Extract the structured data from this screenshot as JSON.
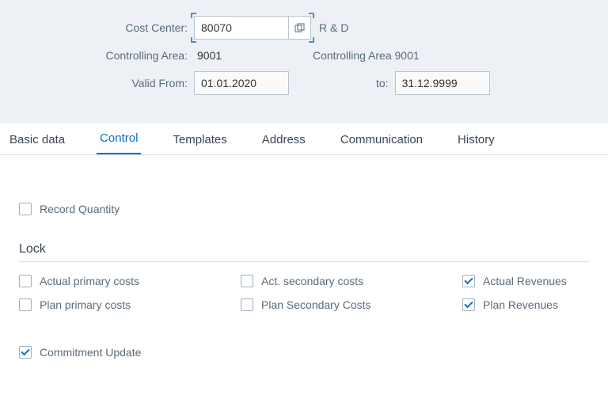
{
  "header": {
    "cost_center_label": "Cost Center:",
    "cost_center_value": "80070",
    "cost_center_desc": "R & D",
    "controlling_area_label": "Controlling Area:",
    "controlling_area_value": "9001",
    "controlling_area_desc": "Controlling Area 9001",
    "valid_from_label": "Valid From:",
    "valid_from_value": "01.01.2020",
    "to_label": "to:",
    "valid_to_value": "31.12.9999"
  },
  "tabs": {
    "items": [
      {
        "label": "Basic data"
      },
      {
        "label": "Control"
      },
      {
        "label": "Templates"
      },
      {
        "label": "Address"
      },
      {
        "label": "Communication"
      },
      {
        "label": "History"
      }
    ],
    "active_index": 1
  },
  "control": {
    "record_quantity": {
      "label": "Record Quantity",
      "checked": false
    },
    "lock_section_title": "Lock",
    "locks": {
      "actual_primary": {
        "label": "Actual primary costs",
        "checked": false
      },
      "act_secondary": {
        "label": "Act. secondary costs",
        "checked": false
      },
      "actual_revenues": {
        "label": "Actual Revenues",
        "checked": true
      },
      "plan_primary": {
        "label": "Plan primary costs",
        "checked": false
      },
      "plan_secondary": {
        "label": "Plan Secondary Costs",
        "checked": false
      },
      "plan_revenues": {
        "label": "Plan Revenues",
        "checked": true
      }
    },
    "commitment_update": {
      "label": "Commitment Update",
      "checked": true
    }
  }
}
